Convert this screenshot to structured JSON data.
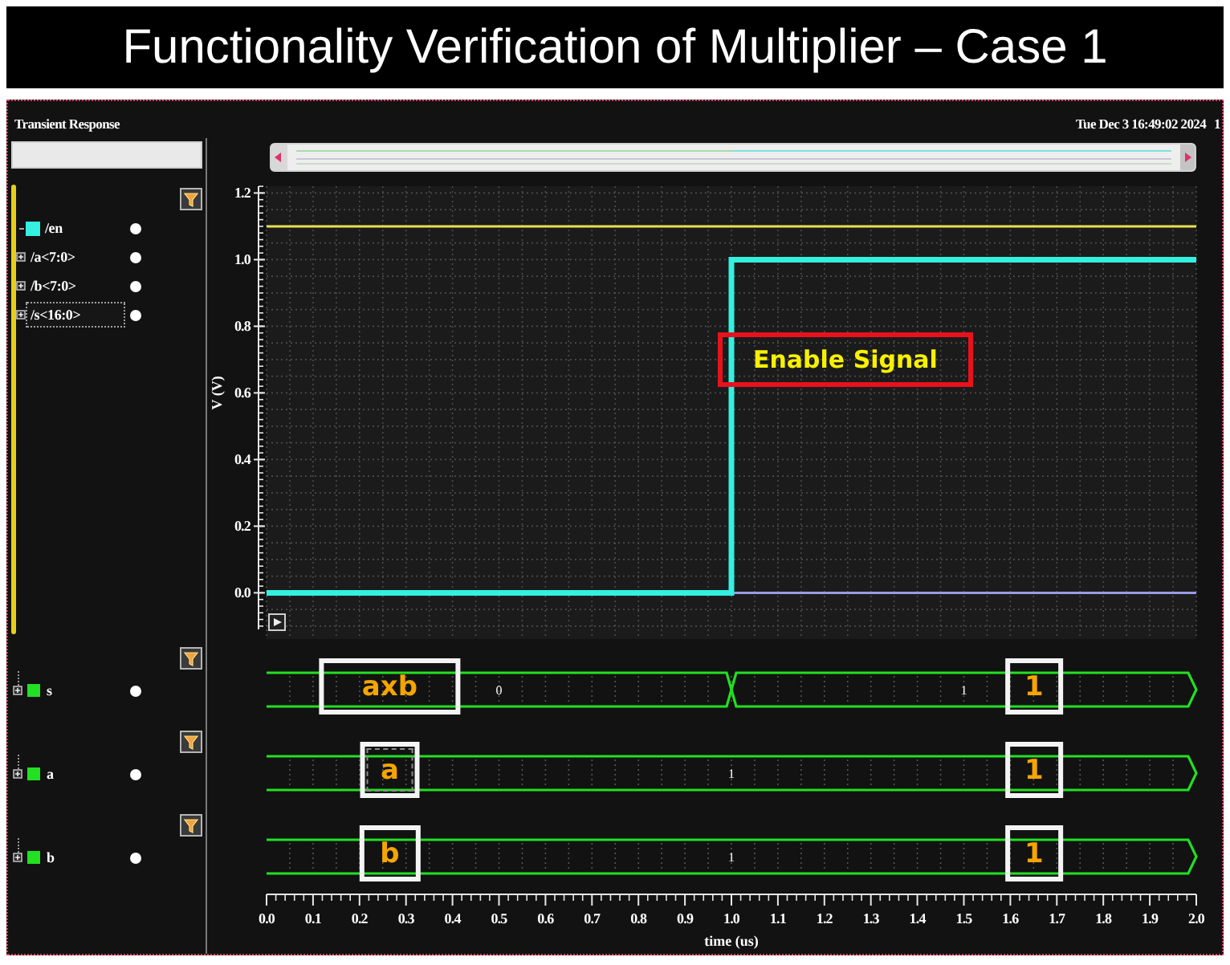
{
  "title": "Functionality Verification of Multiplier – Case 1",
  "window": {
    "title": "Transient Response",
    "timestamp": "Tue Dec 3 16:49:02 2024",
    "trailing_text": "1"
  },
  "analog_signals": [
    {
      "kind": "signal",
      "name": "/en",
      "color": "#33f0e0",
      "selected": false
    },
    {
      "kind": "bus",
      "name": "/a<7:0>",
      "expanded": false,
      "selected": false
    },
    {
      "kind": "bus",
      "name": "/b<7:0>",
      "expanded": false,
      "selected": false
    },
    {
      "kind": "bus",
      "name": "/s<16:0>",
      "expanded": false,
      "selected": true
    }
  ],
  "waveform": {
    "y_axis": {
      "title": "V (V)",
      "ticks": [
        "1.2",
        "1.0",
        "0.8",
        "0.6",
        "0.4",
        "0.2",
        "0.0"
      ]
    },
    "callout": "Enable Signal",
    "buses": [
      {
        "name": "s",
        "color": "#22e022",
        "expanded": false,
        "segments": [
          {
            "value": "0"
          },
          {
            "value": "1"
          }
        ],
        "label_callout": {
          "kind": "solid",
          "text": "axb"
        },
        "value_callout": "1"
      },
      {
        "name": "a",
        "color": "#22e022",
        "expanded": false,
        "segments": [
          {
            "value": "1"
          }
        ],
        "label_callout": {
          "kind": "dotted",
          "text": "a"
        },
        "value_callout": "1"
      },
      {
        "name": "b",
        "color": "#22e022",
        "expanded": false,
        "segments": [
          {
            "value": "1"
          }
        ],
        "label_callout": {
          "kind": "solid",
          "text": "b"
        },
        "value_callout": "1"
      }
    ],
    "time_axis": {
      "ticks": [
        "0.0",
        "0.1",
        "0.2",
        "0.3",
        "0.4",
        "0.5",
        "0.6",
        "0.7",
        "0.8",
        "0.9",
        "1.0",
        "1.1",
        "1.2",
        "1.3",
        "1.4",
        "1.5",
        "1.6",
        "1.7",
        "1.8",
        "1.9",
        "2.0"
      ],
      "label": "time (us)"
    }
  }
}
